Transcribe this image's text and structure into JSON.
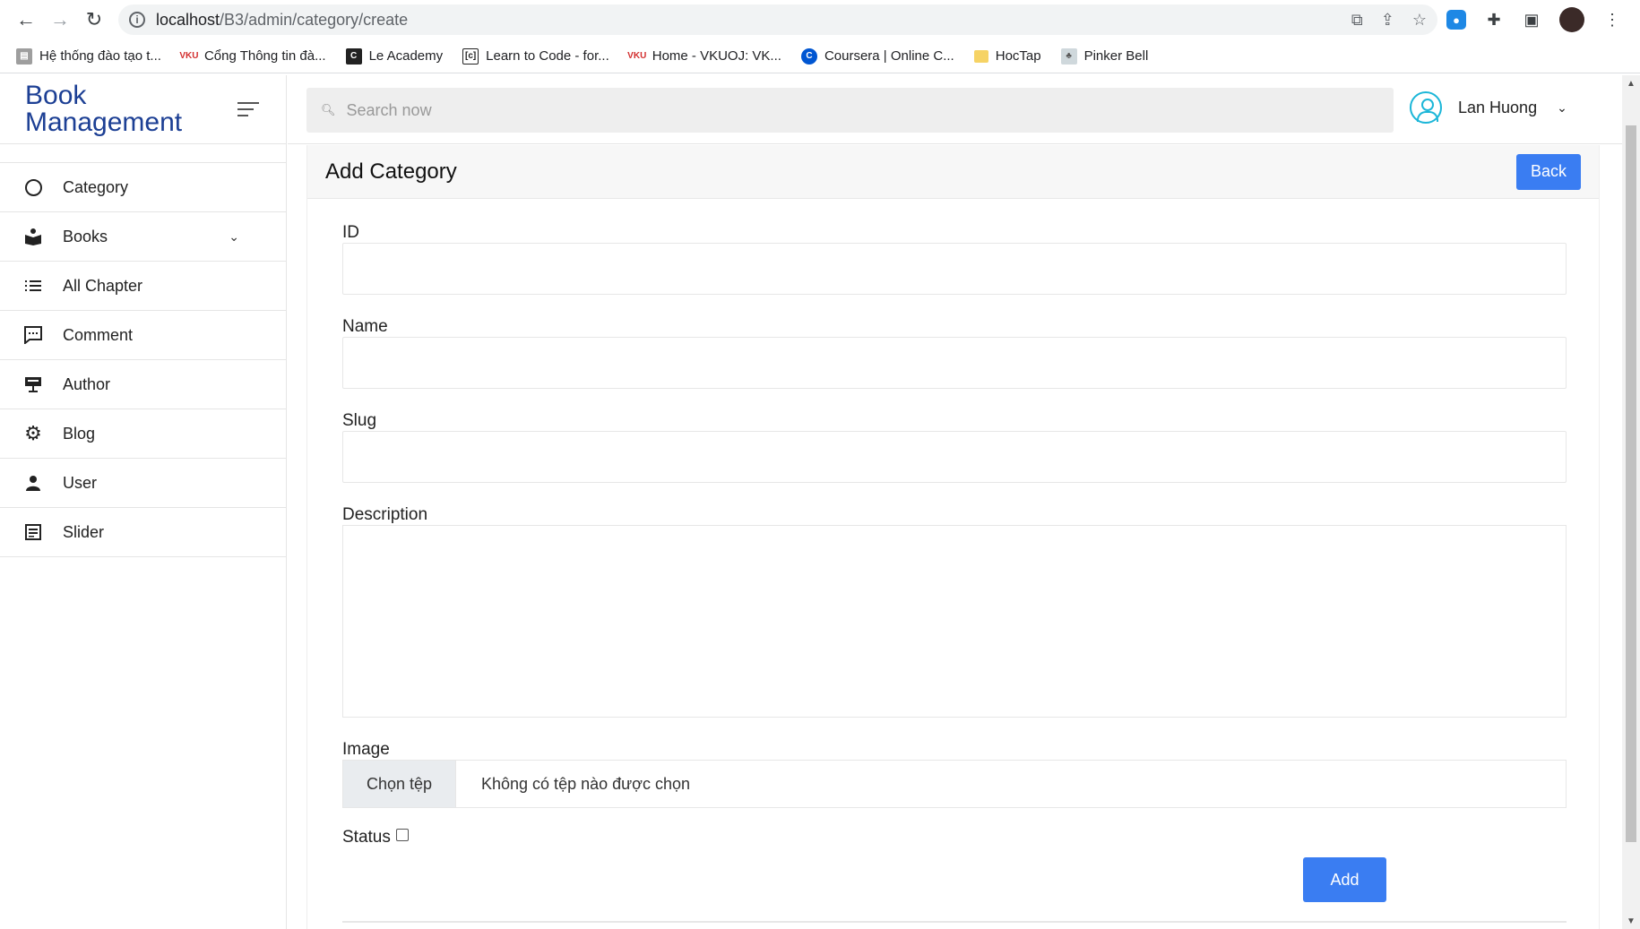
{
  "browser": {
    "url_host": "localhost",
    "url_path": "/B3/admin/category/create",
    "bookmarks": [
      {
        "label": "Hệ thống đào tạo t..."
      },
      {
        "label": "Cổng Thông tin đà..."
      },
      {
        "label": "Le Academy"
      },
      {
        "label": "Learn to Code - for..."
      },
      {
        "label": "Home - VKUOJ: VK..."
      },
      {
        "label": "Coursera | Online C..."
      },
      {
        "label": "HocTap"
      },
      {
        "label": "Pinker Bell"
      }
    ]
  },
  "sidebar": {
    "brand_line1": "Book",
    "brand_line2": "Management",
    "items": [
      {
        "label": "Category",
        "icon": "circle-icon"
      },
      {
        "label": "Books",
        "icon": "book-reader-icon"
      },
      {
        "label": "All Chapter",
        "icon": "list-icon"
      },
      {
        "label": "Comment",
        "icon": "comment-icon"
      },
      {
        "label": "Author",
        "icon": "author-icon"
      },
      {
        "label": "Blog",
        "icon": "gear-icon"
      },
      {
        "label": "User",
        "icon": "user-icon"
      },
      {
        "label": "Slider",
        "icon": "document-icon"
      }
    ]
  },
  "topbar": {
    "search_placeholder": "Search now",
    "user_name": "Lan Huong"
  },
  "card": {
    "title": "Add Category",
    "back_label": "Back"
  },
  "form": {
    "id_label": "ID",
    "name_label": "Name",
    "slug_label": "Slug",
    "description_label": "Description",
    "image_label": "Image",
    "file_button": "Chọn tệp",
    "file_status": "Không có tệp nào được chọn",
    "status_label": "Status",
    "status_checked": false,
    "add_label": "Add"
  },
  "colors": {
    "brand": "#1c3f94",
    "primary_button": "#3a7df2",
    "avatar": "#1bb6d8"
  }
}
